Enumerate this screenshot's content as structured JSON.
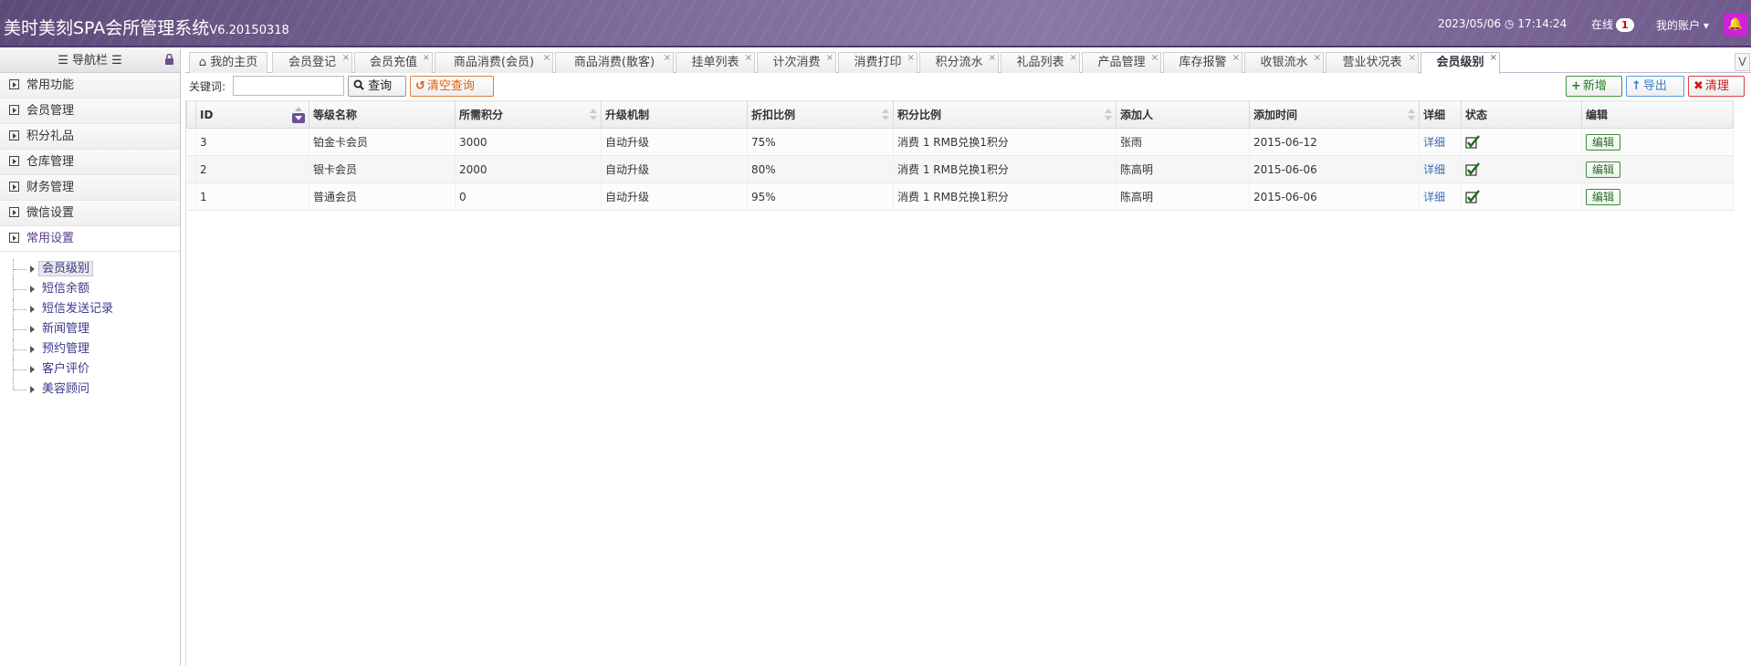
{
  "header": {
    "title": "美时美刻SPA会所管理系统",
    "version": "V6.20150318",
    "datetime": "2023/05/06",
    "time": "17:14:24",
    "online_label": "在线",
    "online_count": "1",
    "account_label": "我的账户"
  },
  "sidebar": {
    "title": "导航栏",
    "menu": [
      {
        "label": "常用功能"
      },
      {
        "label": "会员管理"
      },
      {
        "label": "积分礼品"
      },
      {
        "label": "仓库管理"
      },
      {
        "label": "财务管理"
      },
      {
        "label": "微信设置"
      },
      {
        "label": "常用设置"
      }
    ],
    "tree": [
      {
        "label": "会员级别"
      },
      {
        "label": "短信余额"
      },
      {
        "label": "短信发送记录"
      },
      {
        "label": "新闻管理"
      },
      {
        "label": "预约管理"
      },
      {
        "label": "客户评价"
      },
      {
        "label": "美容顾问"
      }
    ]
  },
  "tabs": [
    {
      "label": "我的主页"
    },
    {
      "label": "会员登记"
    },
    {
      "label": "会员充值"
    },
    {
      "label": "商品消费(会员)"
    },
    {
      "label": "商品消费(散客)"
    },
    {
      "label": "挂单列表"
    },
    {
      "label": "计次消费"
    },
    {
      "label": "消费打印"
    },
    {
      "label": "积分流水"
    },
    {
      "label": "礼品列表"
    },
    {
      "label": "产品管理"
    },
    {
      "label": "库存报警"
    },
    {
      "label": "收银流水"
    },
    {
      "label": "营业状况表"
    },
    {
      "label": "会员级别"
    }
  ],
  "toolbar": {
    "keyword_label": "关键词:",
    "keyword_value": "",
    "search_label": "查询",
    "clear_label": "清空查询",
    "add_label": "新增",
    "export_label": "导出",
    "clean_label": "清理"
  },
  "grid": {
    "columns": [
      "ID",
      "等级名称",
      "所需积分",
      "升级机制",
      "折扣比例",
      "积分比例",
      "添加人",
      "添加时间",
      "详细",
      "状态",
      "编辑"
    ],
    "rows": [
      {
        "id": "3",
        "name": "铂金卡会员",
        "points": "3000",
        "mechanism": "自动升级",
        "discount": "75%",
        "ratio": "消费 1 RMB兑换1积分",
        "adder": "张雨",
        "date": "2015-06-12",
        "detail": "详细",
        "edit": "编辑"
      },
      {
        "id": "2",
        "name": "银卡会员",
        "points": "2000",
        "mechanism": "自动升级",
        "discount": "80%",
        "ratio": "消费 1 RMB兑换1积分",
        "adder": "陈高明",
        "date": "2015-06-06",
        "detail": "详细",
        "edit": "编辑"
      },
      {
        "id": "1",
        "name": "普通会员",
        "points": "0",
        "mechanism": "自动升级",
        "discount": "95%",
        "ratio": "消费 1 RMB兑换1积分",
        "adder": "陈高明",
        "date": "2015-06-06",
        "detail": "详细",
        "edit": "编辑"
      }
    ]
  },
  "icons": {
    "home": "home-icon",
    "clock": "clock-icon",
    "bell": "bell-icon",
    "lock": "lock-icon",
    "search": "search-icon",
    "refresh": "refresh-icon",
    "plus": "plus-icon",
    "export": "arrow-up-icon",
    "clean": "x-icon",
    "status": "check-icon"
  },
  "colors": {
    "header_bg": "#7a6696",
    "accent": "#5a3d86",
    "online_badge": "#d40000",
    "bell_bg": "#d020d8"
  }
}
